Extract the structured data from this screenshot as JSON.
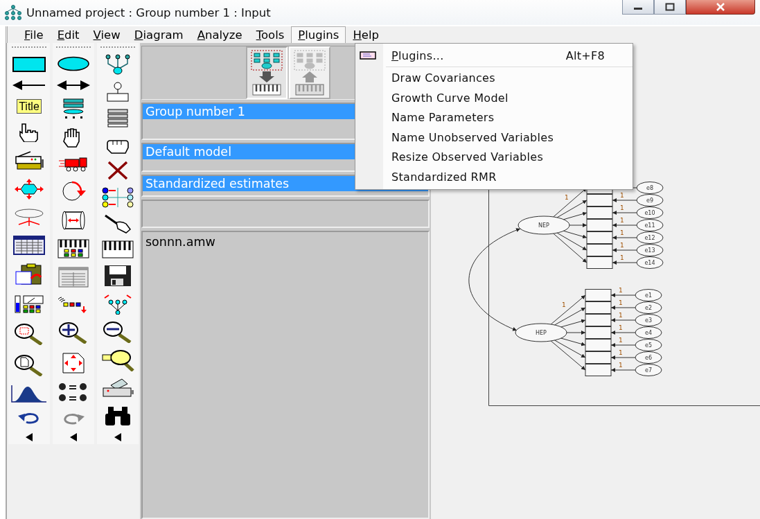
{
  "window": {
    "title": "Unnamed project : Group number 1 : Input"
  },
  "menu_bar": [
    {
      "label": "File",
      "selected": false
    },
    {
      "label": "Edit",
      "selected": false
    },
    {
      "label": "View",
      "selected": false
    },
    {
      "label": "Diagram",
      "selected": false
    },
    {
      "label": "Analyze",
      "selected": false
    },
    {
      "label": "Tools",
      "selected": false
    },
    {
      "label": "Plugins",
      "selected": true
    },
    {
      "label": "Help",
      "selected": false
    }
  ],
  "plugins_menu": [
    {
      "kind": "command",
      "label": "Plugins...",
      "shortcut": "Alt+F8",
      "mnemonic": true
    },
    {
      "kind": "plugin",
      "label": "Draw Covariances",
      "mnemonic": false
    },
    {
      "kind": "plugin",
      "label": "Growth Curve Model",
      "mnemonic": false
    },
    {
      "kind": "plugin",
      "label": "Name Parameters",
      "mnemonic": false
    },
    {
      "kind": "plugin",
      "label": "Name Unobserved Variables",
      "mnemonic": false
    },
    {
      "kind": "plugin",
      "label": "Resize Observed Variables",
      "mnemonic": false
    },
    {
      "kind": "plugin",
      "label": "Standardized RMR",
      "mnemonic": false
    }
  ],
  "toolbox": {
    "title_tool": "Title"
  },
  "view_buttons": [
    {
      "kind": "input",
      "selected": true,
      "disabled": false
    },
    {
      "kind": "output",
      "selected": false,
      "disabled": true
    }
  ],
  "groups": [
    {
      "label": "Group number 1",
      "selected": true
    }
  ],
  "models": [
    {
      "label": "Default model",
      "selected": true
    }
  ],
  "output_views": [
    {
      "label": "Standardized estimates",
      "selected": true
    }
  ],
  "file_name": "sonnn.amw",
  "diagram": {
    "factors": [
      {
        "name": "NEP",
        "loading_label": "1",
        "indicators": [
          {
            "error": "e8"
          },
          {
            "error": "e9",
            "label": "1"
          },
          {
            "error": "e10",
            "label": "1"
          },
          {
            "error": "e11",
            "label": "1"
          },
          {
            "error": "e12",
            "label": "1"
          },
          {
            "error": "e13",
            "label": "1"
          },
          {
            "error": "e14",
            "label": "1"
          }
        ]
      },
      {
        "name": "HEP",
        "loading_label": "1",
        "indicators": [
          {
            "error": "e1",
            "label": "1"
          },
          {
            "error": "e2",
            "label": "1"
          },
          {
            "error": "e3",
            "label": "1"
          },
          {
            "error": "e4",
            "label": "1"
          },
          {
            "error": "e5",
            "label": "1"
          },
          {
            "error": "e6",
            "label": "1"
          },
          {
            "error": "e7",
            "label": "1"
          }
        ]
      }
    ]
  }
}
